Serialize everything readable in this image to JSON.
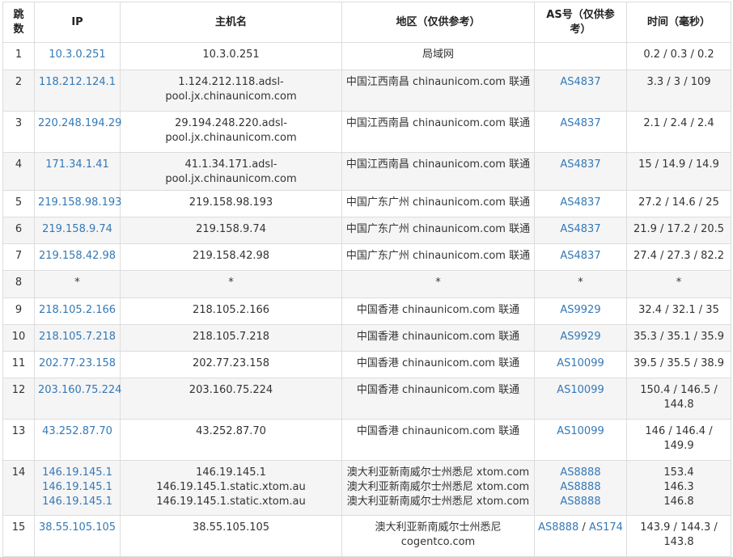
{
  "headers": {
    "hop": "跳数",
    "ip": "IP",
    "host": "主机名",
    "region": "地区（仅供参考）",
    "as": "AS号（仅供参考）",
    "time": "时间（毫秒）"
  },
  "rows": [
    {
      "hop": "1",
      "ip": [
        "10.3.0.251"
      ],
      "host": [
        "10.3.0.251"
      ],
      "region": [
        "局域网"
      ],
      "as": [],
      "time": [
        "0.2 / 0.3 / 0.2"
      ]
    },
    {
      "hop": "2",
      "ip": [
        "118.212.124.1"
      ],
      "host": [
        "1.124.212.118.adsl-",
        "pool.jx.chinaunicom.com"
      ],
      "region": [
        "中国江西南昌 chinaunicom.com 联通"
      ],
      "as": [
        "AS4837"
      ],
      "time": [
        "3.3 / 3 / 109"
      ]
    },
    {
      "hop": "3",
      "ip": [
        "220.248.194.29"
      ],
      "host": [
        "29.194.248.220.adsl-",
        "pool.jx.chinaunicom.com"
      ],
      "region": [
        "中国江西南昌 chinaunicom.com 联通"
      ],
      "as": [
        "AS4837"
      ],
      "time": [
        "2.1 / 2.4 / 2.4"
      ]
    },
    {
      "hop": "4",
      "ip": [
        "171.34.1.41"
      ],
      "host": [
        "41.1.34.171.adsl-pool.jx.chinaunicom.com"
      ],
      "region": [
        "中国江西南昌 chinaunicom.com 联通"
      ],
      "as": [
        "AS4837"
      ],
      "time": [
        "15 / 14.9 / 14.9"
      ]
    },
    {
      "hop": "5",
      "ip": [
        "219.158.98.193"
      ],
      "host": [
        "219.158.98.193"
      ],
      "region": [
        "中国广东广州 chinaunicom.com 联通"
      ],
      "as": [
        "AS4837"
      ],
      "time": [
        "27.2 / 14.6 / 25"
      ]
    },
    {
      "hop": "6",
      "ip": [
        "219.158.9.74"
      ],
      "host": [
        "219.158.9.74"
      ],
      "region": [
        "中国广东广州 chinaunicom.com 联通"
      ],
      "as": [
        "AS4837"
      ],
      "time": [
        "21.9 / 17.2 / 20.5"
      ]
    },
    {
      "hop": "7",
      "ip": [
        "219.158.42.98"
      ],
      "host": [
        "219.158.42.98"
      ],
      "region": [
        "中国广东广州 chinaunicom.com 联通"
      ],
      "as": [
        "AS4837"
      ],
      "time": [
        "27.4 / 27.3 / 82.2"
      ]
    },
    {
      "hop": "8",
      "ip_plain": "*",
      "host": [
        "*"
      ],
      "region": [
        "*"
      ],
      "as_plain": "*",
      "time": [
        "*"
      ]
    },
    {
      "hop": "9",
      "ip": [
        "218.105.2.166"
      ],
      "host": [
        "218.105.2.166"
      ],
      "region": [
        "中国香港 chinaunicom.com 联通"
      ],
      "as": [
        "AS9929"
      ],
      "time": [
        "32.4 / 32.1 / 35"
      ]
    },
    {
      "hop": "10",
      "ip": [
        "218.105.7.218"
      ],
      "host": [
        "218.105.7.218"
      ],
      "region": [
        "中国香港 chinaunicom.com 联通"
      ],
      "as": [
        "AS9929"
      ],
      "time": [
        "35.3 / 35.1 / 35.9"
      ]
    },
    {
      "hop": "11",
      "ip": [
        "202.77.23.158"
      ],
      "host": [
        "202.77.23.158"
      ],
      "region": [
        "中国香港 chinaunicom.com 联通"
      ],
      "as": [
        "AS10099"
      ],
      "time": [
        "39.5 / 35.5 / 38.9"
      ]
    },
    {
      "hop": "12",
      "ip": [
        "203.160.75.224"
      ],
      "host": [
        "203.160.75.224"
      ],
      "region": [
        "中国香港 chinaunicom.com 联通"
      ],
      "as": [
        "AS10099"
      ],
      "time": [
        "150.4 / 146.5 /",
        "144.8"
      ]
    },
    {
      "hop": "13",
      "ip": [
        "43.252.87.70"
      ],
      "host": [
        "43.252.87.70"
      ],
      "region": [
        "中国香港 chinaunicom.com 联通"
      ],
      "as": [
        "AS10099"
      ],
      "time": [
        "146 / 146.4 /",
        "149.9"
      ]
    },
    {
      "hop": "14",
      "ip": [
        "146.19.145.1",
        "146.19.145.1",
        "146.19.145.1"
      ],
      "host": [
        "146.19.145.1",
        "146.19.145.1.static.xtom.au",
        "146.19.145.1.static.xtom.au"
      ],
      "region": [
        "澳大利亚新南威尔士州悉尼 xtom.com",
        "澳大利亚新南威尔士州悉尼 xtom.com",
        "澳大利亚新南威尔士州悉尼 xtom.com"
      ],
      "as": [
        "AS8888",
        "AS8888",
        "AS8888"
      ],
      "time": [
        "153.4",
        "146.3",
        "146.8"
      ]
    },
    {
      "hop": "15",
      "ip": [
        "38.55.105.105"
      ],
      "host": [
        "38.55.105.105"
      ],
      "region": [
        "澳大利亚新南威尔士州悉尼",
        "cogentco.com"
      ],
      "as_pair": [
        "AS8888",
        "AS174"
      ],
      "as_sep": " / ",
      "time": [
        "143.9 / 144.3 /",
        "143.8"
      ]
    }
  ]
}
